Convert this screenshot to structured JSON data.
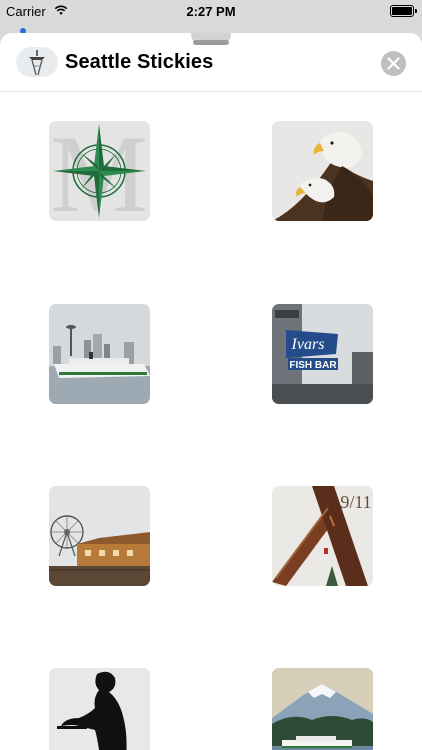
{
  "status_bar": {
    "carrier": "Carrier",
    "time": "2:27 PM"
  },
  "header": {
    "title": "Seattle Stickies",
    "app_icon": "space-needle-icon",
    "close_icon": "close-icon"
  },
  "stickers": [
    {
      "id": "compass-monogram",
      "monogram": "M"
    },
    {
      "id": "bald-eagles"
    },
    {
      "id": "ferry-skyline"
    },
    {
      "id": "ivars-fish-bar",
      "sign_line1": "Ivars",
      "sign_line2": "FISH BAR"
    },
    {
      "id": "great-wheel-waterfront"
    },
    {
      "id": "nine-eleven-memorial",
      "caption": "9/11"
    },
    {
      "id": "silhouette-sculpture"
    },
    {
      "id": "mount-rainier-ferry"
    }
  ],
  "colors": {
    "sheet": "#ffffff",
    "backdrop": "#d9d9d9",
    "close_button": "#bfbfbf",
    "compass_green": "#1f6b3a"
  }
}
